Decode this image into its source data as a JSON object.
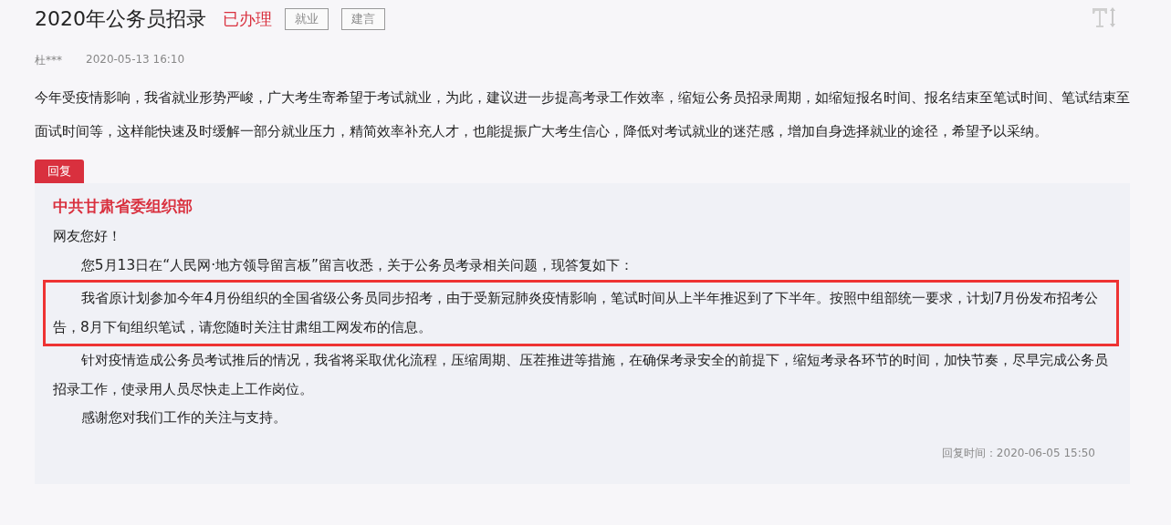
{
  "title": "2020年公务员招录",
  "status": "已办理",
  "tags": [
    "就业",
    "建言"
  ],
  "author": "杜***",
  "date": "2020-05-13 16:10",
  "message": "今年受疫情影响，我省就业形势严峻，广大考生寄希望于考试就业，为此，建议进一步提高考录工作效率，缩短公务员招录周期，如缩短报名时间、报名结束至笔试时间、笔试结束至面试时间等，这样能快速及时缓解一部分就业压力，精简效率补充人才，也能提振广大考生信心，降低对考试就业的迷茫感，增加自身选择就业的途径，希望予以采纳。",
  "reply": {
    "label": "回复",
    "org": "中共甘肃省委组织部",
    "paragraphs": [
      {
        "text": "网友您好！",
        "indent": false,
        "highlighted": false
      },
      {
        "text": "您5月13日在“人民网·地方领导留言板”留言收悉，关于公务员考录相关问题，现答复如下：",
        "indent": true,
        "highlighted": false
      },
      {
        "text": "我省原计划参加今年4月份组织的全国省级公务员同步招考，由于受新冠肺炎疫情影响，笔试时间从上半年推迟到了下半年。按照中组部统一要求，计划7月份发布招考公告，8月下旬组织笔试，请您随时关注甘肃组工网发布的信息。",
        "indent": true,
        "highlighted": true
      },
      {
        "text": "针对疫情造成公务员考试推后的情况，我省将采取优化流程，压缩周期、压茬推进等措施，在确保考录安全的前提下，缩短考录各环节的时间，加快节奏，尽早完成公务员招录工作，使录用人员尽快走上工作岗位。",
        "indent": true,
        "highlighted": false
      },
      {
        "text": "感谢您对我们工作的关注与支持。",
        "indent": true,
        "highlighted": false
      }
    ],
    "time": "回复时间：2020-06-05 15:50"
  }
}
